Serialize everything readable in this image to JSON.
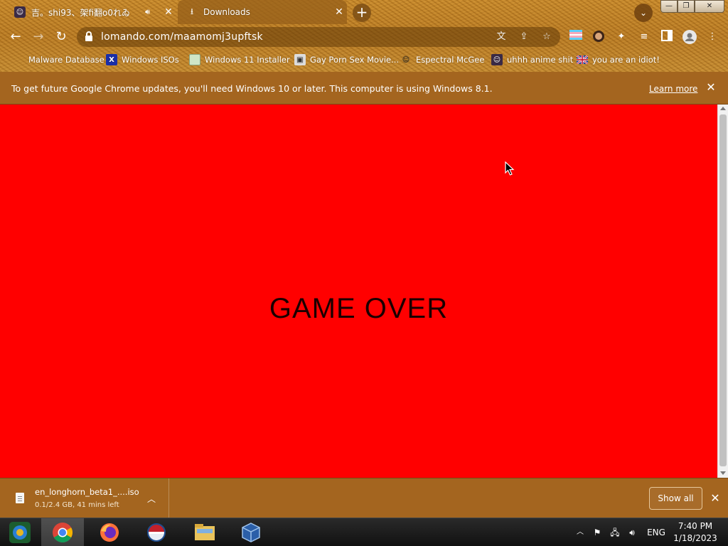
{
  "tabs": [
    {
      "title": "吉。shi93、架fi翻o0れゐ",
      "audio_icon": "speaker-icon",
      "close": "✕"
    },
    {
      "title": "Downloads",
      "close": "✕"
    }
  ],
  "new_tab_label": "+",
  "window_controls": {
    "minimize": "—",
    "maximize": "❐",
    "close": "✕"
  },
  "toolbar": {
    "back": "←",
    "forward": "→",
    "reload": "↻",
    "url": "lomando.com/maamomj3upftsk"
  },
  "bookmarks": [
    {
      "label": "Malware Database"
    },
    {
      "label": "Windows ISOs"
    },
    {
      "label": "Windows 11 Installer"
    },
    {
      "label": "Gay Porn Sex Movie..."
    },
    {
      "label": "Espectral McGee"
    },
    {
      "label": "uhhh anime shit"
    },
    {
      "label": "you are an idiot!"
    }
  ],
  "infobar": {
    "message": "To get future Google Chrome updates, you'll need Windows 10 or later. This computer is using Windows 8.1.",
    "link": "Learn more",
    "close": "✕"
  },
  "page": {
    "heading": "GAME OVER",
    "background": "#ff0000"
  },
  "download": {
    "filename": "en_longhorn_beta1_....iso",
    "status": "0.1/2.4 GB, 41 mins left",
    "show_all": "Show all",
    "close": "✕"
  },
  "taskbar": {
    "apps": [
      "app-icon",
      "chrome-icon",
      "firefox-icon",
      "ie-icon",
      "file-explorer-icon",
      "virtualbox-icon"
    ],
    "language": "ENG",
    "time": "7:40 PM",
    "date": "1/18/2023"
  }
}
